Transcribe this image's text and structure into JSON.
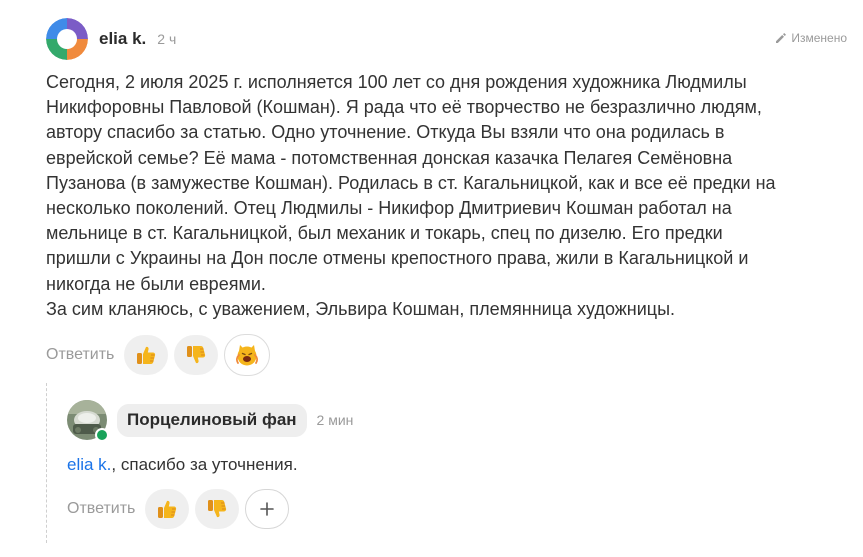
{
  "comment": {
    "author": "elia k.",
    "time": "2 ч",
    "edited_label": "Изменено",
    "body_lines": [
      "Сегодня, 2 июля 2025 г. исполняется 100 лет со дня рождения художника Людмилы",
      "Никифоровны Павловой (Кошман). Я рада что её творчество не безразлично людям,",
      "автору спасибо за статью. Одно уточнение. Откуда Вы взяли что она родилась в",
      "еврейской семье? Её мама - потомственная донская казачка Пелагея Семёновна",
      "Пузанова (в замужестве Кошман). Родилась в ст. Кагальницкой, как и все её предки на",
      "несколько поколений. Отец Людмилы - Никифор Дмитриевич Кошман работал на",
      "мельнице в ст. Кагальницкой, был механик и токарь, спец по дизелю. Его предки",
      "пришли с Украины на Дон после отмены крепостного права, жили в Кагальницкой и",
      "никогда не были евреями.",
      "За сим кланяюсь, с уважением, Эльвира Кошман, племянница художницы."
    ],
    "reply_label": "Ответить",
    "reactions": [
      {
        "icon": "thumbs-up-icon"
      },
      {
        "icon": "thumbs-down-icon"
      },
      {
        "icon": "cat-emoji-icon"
      }
    ]
  },
  "reply": {
    "author": "Порцелиновый фан",
    "time": "2 мин",
    "mention": "elia k.",
    "text": ", спасибо за уточнения.",
    "reply_label": "Ответить",
    "reactions": [
      {
        "icon": "thumbs-up-icon"
      },
      {
        "icon": "thumbs-down-icon"
      }
    ],
    "add_reaction_icon": "plus-icon"
  },
  "colors": {
    "text": "#333333",
    "muted": "#9a9a9a",
    "link": "#1a73e8",
    "online": "#19a35a",
    "reaction_bg": "#efefef",
    "emoji_yellow": "#f5b51c"
  }
}
